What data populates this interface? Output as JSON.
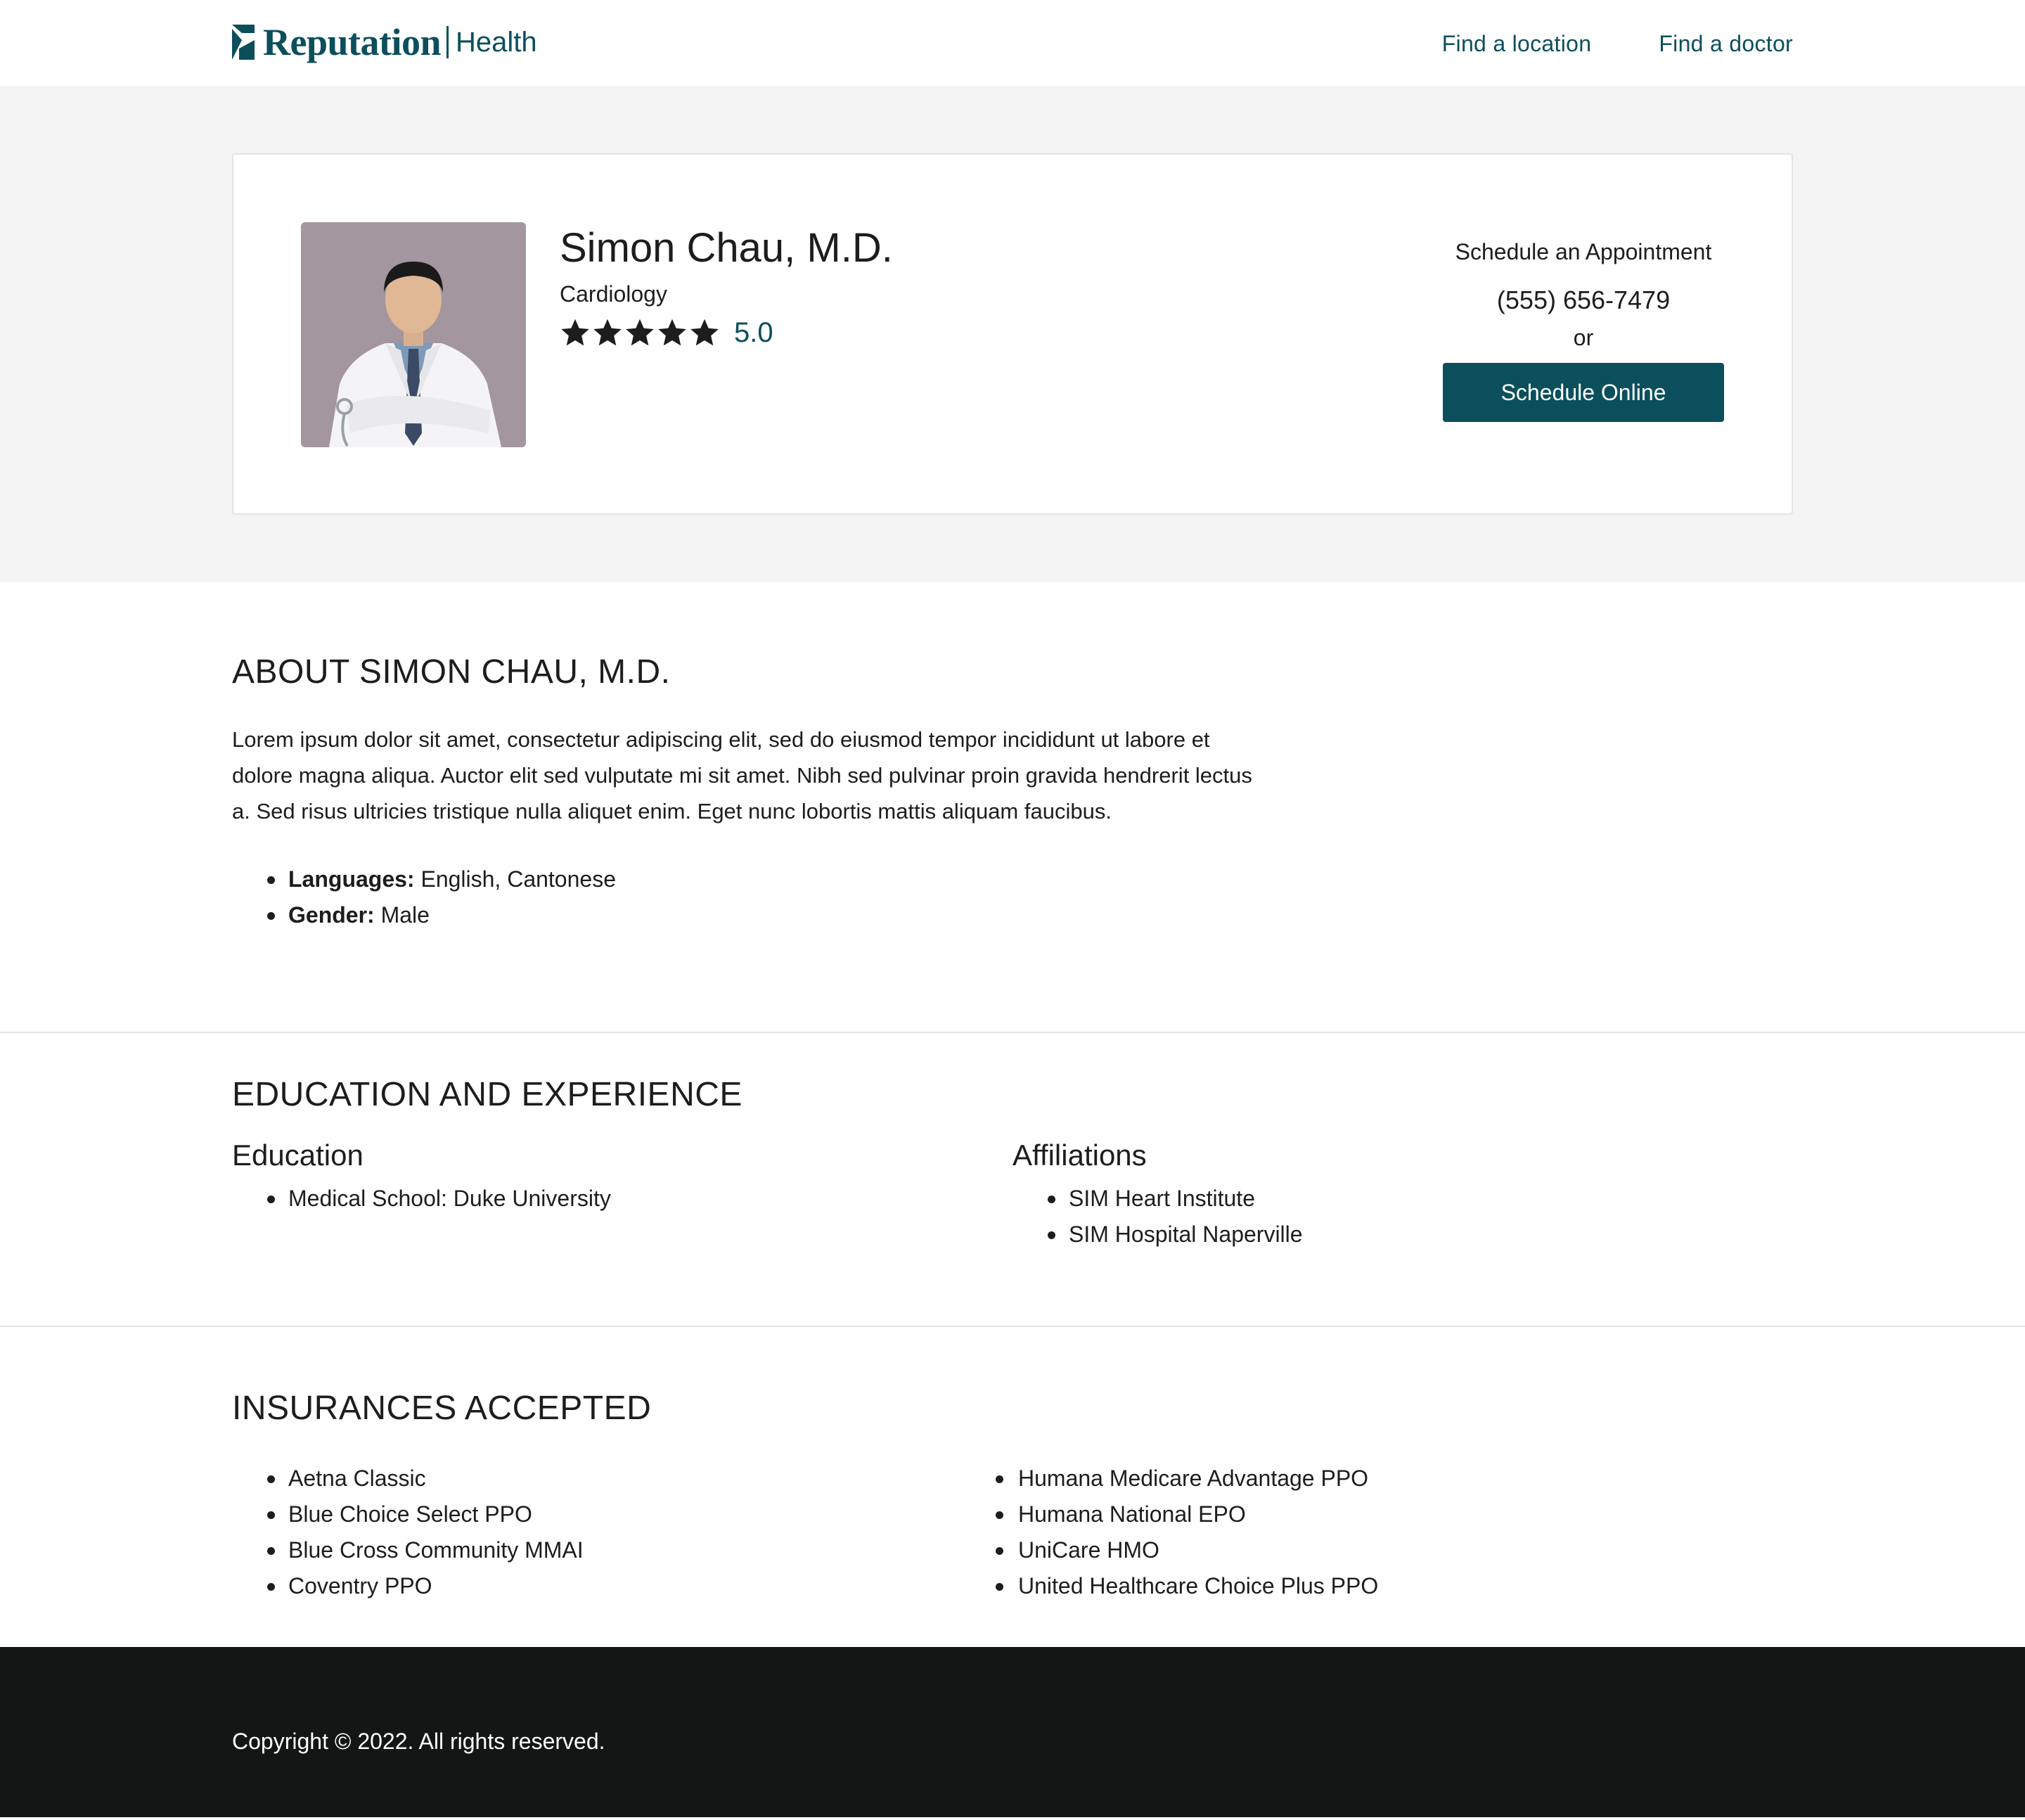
{
  "header": {
    "brand": "Reputation",
    "brand_sub": "Health",
    "nav": [
      {
        "label": "Find a location"
      },
      {
        "label": "Find a doctor"
      }
    ]
  },
  "profile": {
    "name": "Simon Chau, M.D.",
    "specialty": "Cardiology",
    "rating": 5.0,
    "rating_label": "5.0",
    "photo_icon": "doctor-portrait"
  },
  "schedule": {
    "title": "Schedule an Appointment",
    "phone": "(555) 656-7479",
    "or": "or",
    "button": "Schedule Online"
  },
  "about": {
    "title": "ABOUT SIMON CHAU, M.D.",
    "body": "Lorem ipsum dolor sit amet, consectetur adipiscing elit, sed do eiusmod tempor incididunt ut labore et dolore magna aliqua. Auctor elit sed vulputate mi sit amet. Nibh sed pulvinar proin gravida hendrerit lectus a. Sed risus ultricies tristique nulla aliquet enim. Eget nunc lobortis mattis aliquam faucibus.",
    "details": [
      {
        "label": "Languages:",
        "value": " English, Cantonese"
      },
      {
        "label": "Gender:",
        "value": " Male"
      }
    ]
  },
  "education": {
    "title": "EDUCATION AND EXPERIENCE",
    "education_heading": "Education",
    "education_items": [
      "Medical School: Duke University"
    ],
    "affiliations_heading": "Affiliations",
    "affiliations_items": [
      "SIM Heart Institute",
      "SIM Hospital Naperville"
    ]
  },
  "insurances": {
    "title": "INSURANCES ACCEPTED",
    "left": [
      "Aetna Classic",
      "Blue Choice Select PPO",
      "Blue Cross Community MMAI",
      "Coventry PPO"
    ],
    "right": [
      "Humana Medicare Advantage PPO",
      "Humana National EPO",
      "UniCare HMO",
      "United Healthcare Choice Plus PPO"
    ]
  },
  "footer": {
    "copyright": "Copyright © 2022. All rights reserved."
  },
  "colors": {
    "brand": "#0b4f5c",
    "hero_bg": "#f3f4f3",
    "footer_bg": "#141615",
    "text": "#1c1d1e"
  }
}
